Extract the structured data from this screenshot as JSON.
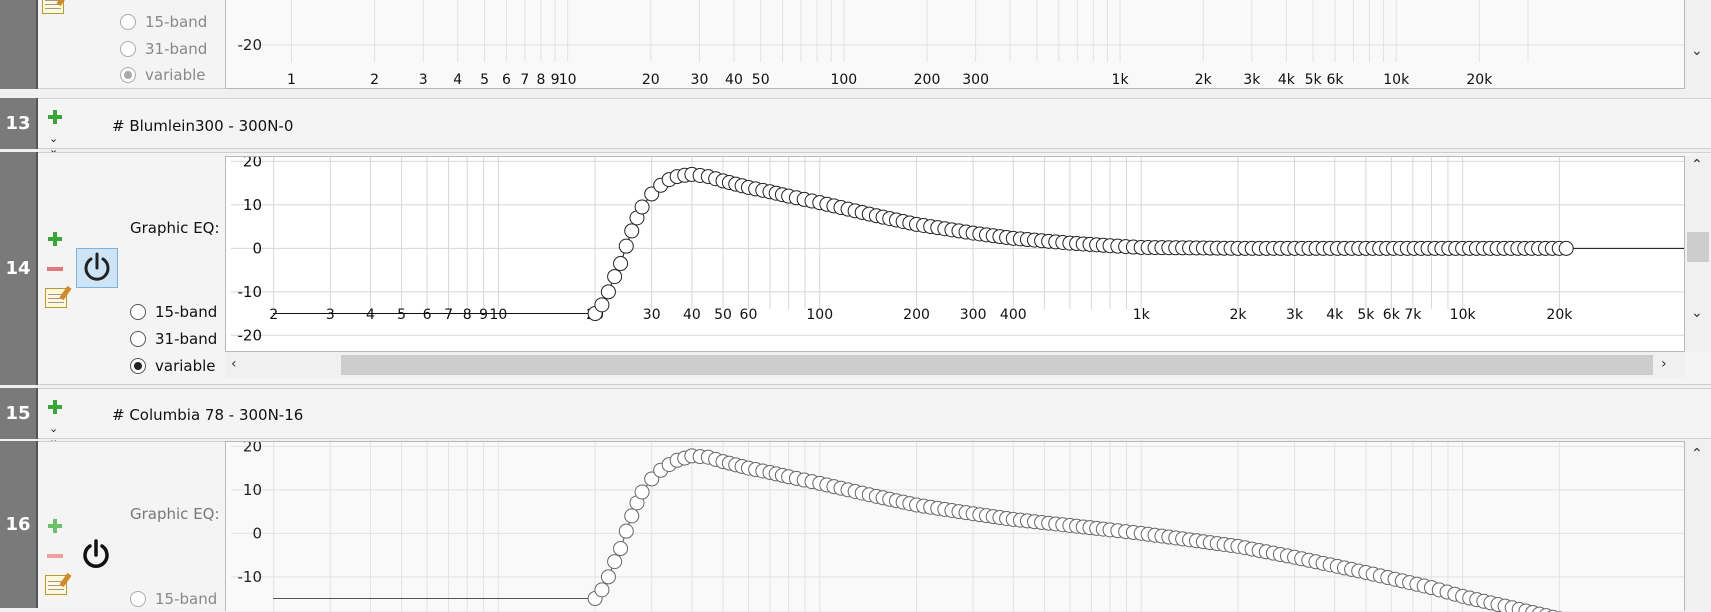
{
  "ylabels": [
    "20",
    "10",
    "0",
    "-10",
    "-20"
  ],
  "xlabels_row12": [
    "1",
    "2",
    "3",
    "4",
    "5",
    "6",
    "7",
    "8",
    "9",
    "10",
    "20",
    "30",
    "40",
    "50",
    "100",
    "200",
    "300",
    "1k",
    "2k",
    "3k",
    "4k",
    "5k",
    "6k",
    "10k",
    "20k"
  ],
  "xlabels_row14": [
    "2",
    "3",
    "4",
    "5",
    "6",
    "7",
    "8",
    "9",
    "10",
    "20",
    "30",
    "40",
    "50",
    "60",
    "100",
    "200",
    "300",
    "400",
    "1k",
    "2k",
    "3k",
    "4k",
    "5k",
    "6k",
    "7k",
    "10k",
    "20k"
  ],
  "rows": {
    "r12": {
      "radio_15": "15-band",
      "radio_31": "31-band",
      "radio_var": "variable",
      "ylabel": "-20"
    },
    "r13": {
      "number": "13",
      "comment": "# Blumlein300 - 300N-0"
    },
    "r14": {
      "number": "14",
      "eq_label": "Graphic EQ:",
      "radio_15": "15-band",
      "radio_31": "31-band",
      "radio_var": "variable",
      "selected": "variable",
      "power": "on"
    },
    "r15": {
      "number": "15",
      "comment": "# Columbia 78 - 300N-16"
    },
    "r16": {
      "number": "16",
      "eq_label": "Graphic EQ:",
      "radio_15": "15-band",
      "power": "off"
    }
  },
  "chart_data": [
    {
      "type": "line",
      "id": "row14-graphic-eq",
      "xscale": "log",
      "xlim": [
        1.7,
        26000
      ],
      "ylim": [
        -22,
        21
      ],
      "x": [
        20,
        21,
        22,
        23,
        24,
        25,
        26,
        27,
        28,
        30,
        32,
        34,
        36,
        38,
        40,
        45,
        50,
        60,
        70,
        80,
        100,
        150,
        200,
        300,
        400,
        600,
        800,
        1000,
        2000,
        5000,
        10000,
        21000
      ],
      "y": [
        -15,
        -13,
        -10,
        -6.5,
        -3.5,
        0.5,
        4,
        7,
        9.5,
        12.5,
        14.5,
        15.8,
        16.5,
        16.8,
        17,
        16.5,
        15.5,
        14,
        13,
        12,
        10.5,
        7.5,
        5.5,
        3.5,
        2.3,
        1.2,
        0.6,
        0.2,
        0,
        0,
        0,
        0
      ],
      "line_left_y": -15,
      "line_right_y": 0
    },
    {
      "type": "line",
      "id": "row16-graphic-eq",
      "xscale": "log",
      "xlim": [
        1.7,
        26000
      ],
      "ylim": [
        -22,
        21
      ],
      "x": [
        20,
        21,
        22,
        23,
        24,
        25,
        26,
        27,
        28,
        30,
        32,
        34,
        36,
        38,
        40,
        45,
        50,
        60,
        70,
        80,
        100,
        150,
        200,
        300,
        400,
        600,
        800,
        1000,
        2000,
        3000,
        5000,
        8000,
        10000,
        15000,
        21000
      ],
      "y": [
        -15,
        -13,
        -10,
        -6.5,
        -3.5,
        0.5,
        4,
        7,
        9.5,
        12.5,
        14.5,
        15.8,
        16.8,
        17.3,
        17.8,
        17.5,
        16.5,
        15,
        14,
        13,
        11.5,
        8.5,
        6.5,
        4.5,
        3.2,
        1.8,
        0.8,
        0,
        -3,
        -5.5,
        -9,
        -12.5,
        -14.5,
        -17.5,
        -20
      ],
      "line_left_y": -15,
      "line_right_y": -20
    }
  ]
}
